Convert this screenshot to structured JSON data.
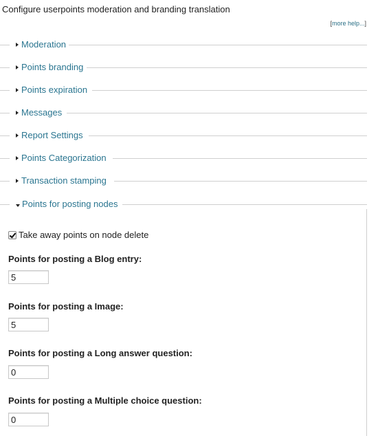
{
  "description": "Configure userpoints moderation and branding translation",
  "help_link": {
    "open": "[",
    "label": "more help...",
    "close": "]"
  },
  "collapsed_sections": [
    {
      "label": "Moderation"
    },
    {
      "label": "Points branding"
    },
    {
      "label": "Points expiration"
    },
    {
      "label": "Messages"
    },
    {
      "label": "Report Settings"
    },
    {
      "label": "Points Categorization"
    },
    {
      "label": "Transaction stamping"
    }
  ],
  "open_section": {
    "label": "Points for posting nodes",
    "checkbox": {
      "label": "Take away points on node delete",
      "checked": true
    },
    "fields": [
      {
        "label": "Points for posting a Blog entry:",
        "value": "5"
      },
      {
        "label": "Points for posting a Image:",
        "value": "5"
      },
      {
        "label": "Points for posting a Long answer question:",
        "value": "0"
      },
      {
        "label": "Points for posting a Multiple choice question:",
        "value": "0"
      }
    ]
  }
}
